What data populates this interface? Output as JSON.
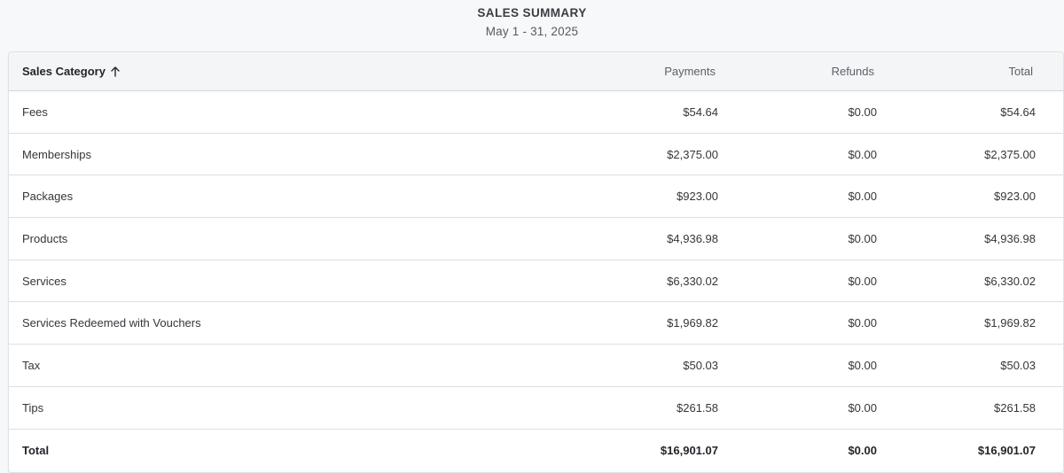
{
  "header": {
    "title": "SALES SUMMARY",
    "date_range": "May 1 - 31, 2025"
  },
  "table": {
    "columns": {
      "category": "Sales Category",
      "payments": "Payments",
      "refunds": "Refunds",
      "total": "Total"
    },
    "sort_icon": "arrow-up-icon",
    "rows": [
      {
        "category": "Fees",
        "payments": "$54.64",
        "refunds": "$0.00",
        "total": "$54.64"
      },
      {
        "category": "Memberships",
        "payments": "$2,375.00",
        "refunds": "$0.00",
        "total": "$2,375.00"
      },
      {
        "category": "Packages",
        "payments": "$923.00",
        "refunds": "$0.00",
        "total": "$923.00"
      },
      {
        "category": "Products",
        "payments": "$4,936.98",
        "refunds": "$0.00",
        "total": "$4,936.98"
      },
      {
        "category": "Services",
        "payments": "$6,330.02",
        "refunds": "$0.00",
        "total": "$6,330.02"
      },
      {
        "category": "Services Redeemed with Vouchers",
        "payments": "$1,969.82",
        "refunds": "$0.00",
        "total": "$1,969.82"
      },
      {
        "category": "Tax",
        "payments": "$50.03",
        "refunds": "$0.00",
        "total": "$50.03"
      },
      {
        "category": "Tips",
        "payments": "$261.58",
        "refunds": "$0.00",
        "total": "$261.58"
      }
    ],
    "totals": {
      "category": "Total",
      "payments": "$16,901.07",
      "refunds": "$0.00",
      "total": "$16,901.07"
    }
  }
}
